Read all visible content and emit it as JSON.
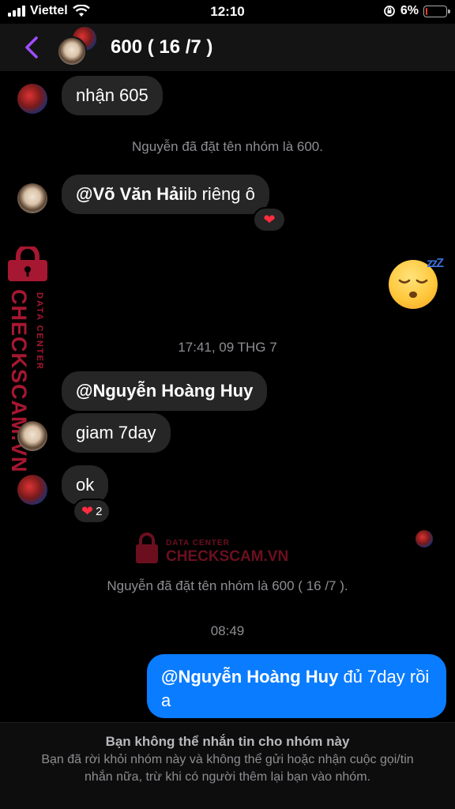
{
  "status_bar": {
    "carrier": "Viettel",
    "time": "12:10",
    "battery": "6%"
  },
  "header": {
    "title": "600 ( 16 /7 )"
  },
  "messages": {
    "m1": "nhận 605",
    "sys1": "Nguyễn đã đặt tên nhóm là 600.",
    "m2_mention": "@Võ Văn Hải",
    "m2_text": " ib riêng ô",
    "timestamp1": "17:41, 09 THG 7",
    "m3_mention": "@Nguyễn Hoàng Huy",
    "m4": "giam 7day",
    "m5": "ok",
    "m5_reaction_count": "2",
    "sys2": "Nguyễn đã đặt tên nhóm là 600 ( 16 /7 ).",
    "timestamp2": "08:49",
    "m6_mention": "@Nguyễn Hoàng Huy",
    "m6_text": " đủ 7day rồi a"
  },
  "watermark": {
    "brand": "CHECKSCAM.VN",
    "sub": "DATA CENTER"
  },
  "footer": {
    "title": "Bạn không thể nhắn tin cho nhóm này",
    "body": "Bạn đã rời khỏi nhóm này và không thể gửi hoặc nhận cuộc gọi/tin nhắn nữa, trừ khi có người thêm lại bạn vào nhóm."
  },
  "colors": {
    "outgoing_bubble": "#0a7cff",
    "incoming_bubble": "#262626",
    "back_chevron": "#a04cff",
    "watermark": "#c41c3a"
  }
}
